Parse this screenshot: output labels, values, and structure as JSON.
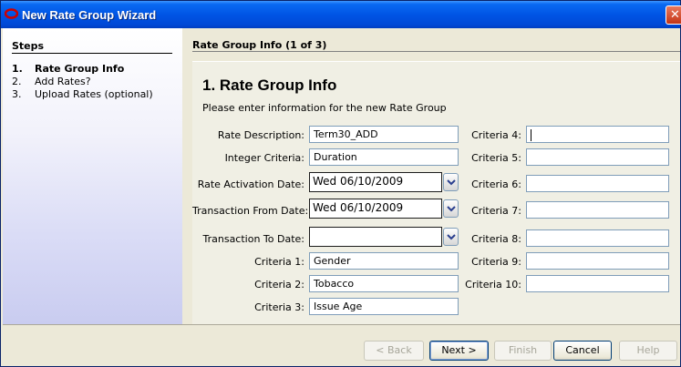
{
  "window": {
    "title": "New Rate Group Wizard"
  },
  "steps": {
    "title": "Steps",
    "items": [
      {
        "num": "1.",
        "label": "Rate Group Info"
      },
      {
        "num": "2.",
        "label": "Add Rates?"
      },
      {
        "num": "3.",
        "label": "Upload Rates (optional)"
      }
    ]
  },
  "content": {
    "header": "Rate Group Info (1 of 3)",
    "title": "1. Rate Group Info",
    "instructions": "Please enter information for the new Rate Group"
  },
  "form": {
    "rate_description": {
      "label": "Rate Description:",
      "value": "Term30_ADD"
    },
    "integer_criteria": {
      "label": "Integer Criteria:",
      "value": "Duration"
    },
    "rate_activation_date": {
      "label": "Rate Activation Date:",
      "value": "Wed 06/10/2009"
    },
    "transaction_from_date": {
      "label": "Transaction From Date:",
      "value": "Wed 06/10/2009"
    },
    "transaction_to_date": {
      "label": "Transaction To Date:",
      "value": ""
    },
    "criteria_1": {
      "label": "Criteria 1:",
      "value": "Gender"
    },
    "criteria_2": {
      "label": "Criteria 2:",
      "value": "Tobacco"
    },
    "criteria_3": {
      "label": "Criteria 3:",
      "value": "Issue Age"
    },
    "criteria_4": {
      "label": "Criteria 4:",
      "value": ""
    },
    "criteria_5": {
      "label": "Criteria 5:",
      "value": ""
    },
    "criteria_6": {
      "label": "Criteria 6:",
      "value": ""
    },
    "criteria_7": {
      "label": "Criteria 7:",
      "value": ""
    },
    "criteria_8": {
      "label": "Criteria 8:",
      "value": ""
    },
    "criteria_9": {
      "label": "Criteria 9:",
      "value": ""
    },
    "criteria_10": {
      "label": "Criteria 10:",
      "value": ""
    }
  },
  "buttons": {
    "back": "< Back",
    "next": "Next >",
    "finish": "Finish",
    "cancel": "Cancel",
    "help": "Help"
  },
  "icons": {
    "app": "oval-logo-icon",
    "close": "close-icon",
    "dropdown": "chevron-down-icon"
  },
  "colors": {
    "titlebar": "#0055e5",
    "app_icon": "#cc0000",
    "close_button": "#c43515"
  }
}
